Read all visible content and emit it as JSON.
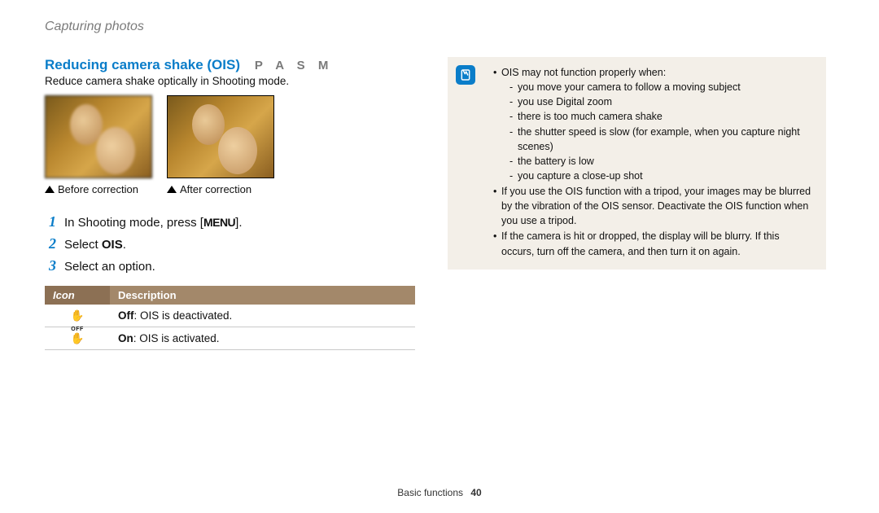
{
  "breadcrumb": "Capturing photos",
  "section": {
    "title": "Reducing camera shake (OIS)",
    "modes": "P A S M",
    "lead": "Reduce camera shake optically in Shooting mode."
  },
  "compare": {
    "before": "Before correction",
    "after": "After correction"
  },
  "steps": [
    {
      "num": "1",
      "pre": "In Shooting mode, press [",
      "btn": "MENU",
      "post": "]."
    },
    {
      "num": "2",
      "text_pre": "Select ",
      "bold": "OIS",
      "text_post": "."
    },
    {
      "num": "3",
      "text": "Select an option."
    }
  ],
  "table": {
    "headers": {
      "icon": "Icon",
      "desc": "Description"
    },
    "rows": [
      {
        "icon_sub": "OFF",
        "bold": "Off",
        "rest": ": OIS is deactivated."
      },
      {
        "icon_sub": "",
        "bold": "On",
        "rest": ": OIS is activated."
      }
    ]
  },
  "notes": {
    "intro": "OIS may not function properly when:",
    "when": [
      "you move your camera to follow a moving subject",
      "you use Digital zoom",
      "there is too much camera shake",
      "the shutter speed is slow (for example, when you capture night scenes)",
      "the battery is low",
      "you capture a close-up shot"
    ],
    "bullets": [
      "If you use the OIS function with a tripod, your images may be blurred by the vibration of the OIS sensor. Deactivate the OIS function when you use a tripod.",
      "If the camera is hit or dropped, the display will be blurry. If this occurs, turn off the camera, and then turn it on again."
    ]
  },
  "footer": {
    "section": "Basic functions",
    "page": "40"
  }
}
